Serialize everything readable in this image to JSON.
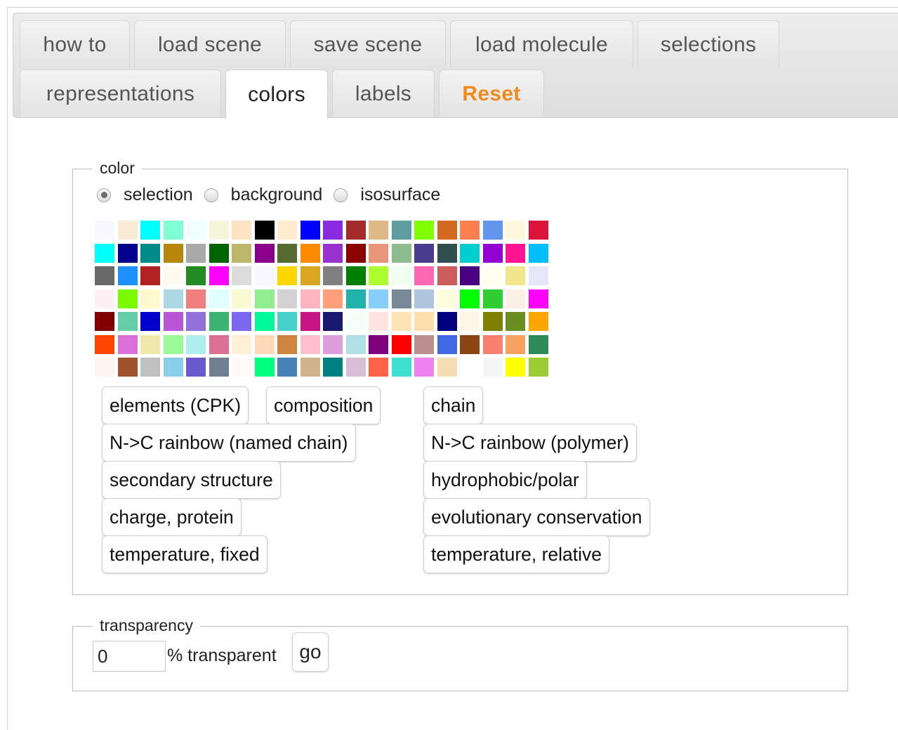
{
  "tabs": {
    "how_to": "how to",
    "load_scene": "load scene",
    "save_scene": "save scene",
    "load_molecule": "load molecule",
    "selections": "selections",
    "representations": "representations",
    "colors": "colors",
    "labels": "labels",
    "reset": "Reset",
    "active": "colors",
    "reset_color": "#f08a1c"
  },
  "color_panel": {
    "legend": "color",
    "targets": {
      "selection": "selection",
      "background": "background",
      "isosurface": "isosurface",
      "checked": "selection"
    },
    "palette": [
      "#f8f8ff",
      "#faebd7",
      "#00ffff",
      "#7fffd4",
      "#f0ffff",
      "#f5f5dc",
      "#ffe4c4",
      "#000000",
      "#ffebcd",
      "#0000ff",
      "#8a2be2",
      "#a52a2a",
      "#deb887",
      "#5f9ea0",
      "#7fff00",
      "#d2691e",
      "#ff7f50",
      "#6495ed",
      "#fff8dc",
      "#dc143c",
      "#00ffff",
      "#00008b",
      "#008b8b",
      "#b8860b",
      "#a9a9a9",
      "#006400",
      "#bdb76b",
      "#8b008b",
      "#556b2f",
      "#ff8c00",
      "#9932cc",
      "#8b0000",
      "#e9967a",
      "#8fbc8f",
      "#483d8b",
      "#2f4f4f",
      "#00ced1",
      "#9400d3",
      "#ff1493",
      "#00bfff",
      "#696969",
      "#1e90ff",
      "#b22222",
      "#fffaf0",
      "#228b22",
      "#ff00ff",
      "#dcdcdc",
      "#f8f8ff",
      "#ffd700",
      "#daa520",
      "#808080",
      "#008000",
      "#adff2f",
      "#f0fff0",
      "#ff69b4",
      "#cd5c5c",
      "#4b0082",
      "#fffff0",
      "#f0e68c",
      "#e6e6fa",
      "#fff0f5",
      "#7cfc00",
      "#fffacd",
      "#add8e6",
      "#f08080",
      "#e0ffff",
      "#fafad2",
      "#90ee90",
      "#d3d3d3",
      "#ffb6c1",
      "#ffa07a",
      "#20b2aa",
      "#87cefa",
      "#778899",
      "#b0c4de",
      "#ffffe0",
      "#00ff00",
      "#32cd32",
      "#faf0e6",
      "#ff00ff",
      "#800000",
      "#66cdaa",
      "#0000cd",
      "#ba55d3",
      "#9370db",
      "#3cb371",
      "#7b68ee",
      "#00fa9a",
      "#48d1cc",
      "#c71585",
      "#191970",
      "#f5fffa",
      "#ffe4e1",
      "#ffe4b5",
      "#ffdead",
      "#000080",
      "#fdf5e6",
      "#808000",
      "#6b8e23",
      "#ffa500",
      "#ff4500",
      "#da70d6",
      "#eee8aa",
      "#98fb98",
      "#afeeee",
      "#db7093",
      "#ffefd5",
      "#ffdab9",
      "#cd853f",
      "#ffc0cb",
      "#dda0dd",
      "#b0e0e6",
      "#800080",
      "#ff0000",
      "#bc8f8f",
      "#4169e1",
      "#8b4513",
      "#fa8072",
      "#f4a460",
      "#2e8b57",
      "#fff5ee",
      "#a0522d",
      "#c0c0c0",
      "#87ceeb",
      "#6a5acd",
      "#708090",
      "#fffafa",
      "#00ff7f",
      "#4682b4",
      "#d2b48c",
      "#008080",
      "#d8bfd8",
      "#ff6347",
      "#40e0d0",
      "#ee82ee",
      "#f5deb3",
      "#ffffff",
      "#f5f5f5",
      "#ffff00",
      "#9acd32"
    ],
    "schemes": {
      "elements_cpk": "elements (CPK)",
      "composition": "composition",
      "chain": "chain",
      "nc_rainbow_named_chain": "N->C rainbow (named chain)",
      "nc_rainbow_polymer": "N->C rainbow (polymer)",
      "secondary_structure": "secondary structure",
      "hydrophobic_polar": "hydrophobic/polar",
      "charge_protein": "charge, protein",
      "evolutionary_conservation": "evolutionary conservation",
      "temperature_fixed": "temperature, fixed",
      "temperature_relative": "temperature, relative"
    }
  },
  "transparency_panel": {
    "legend": "transparency",
    "value": "0",
    "unit_label": "% transparent",
    "go_label": "go"
  }
}
